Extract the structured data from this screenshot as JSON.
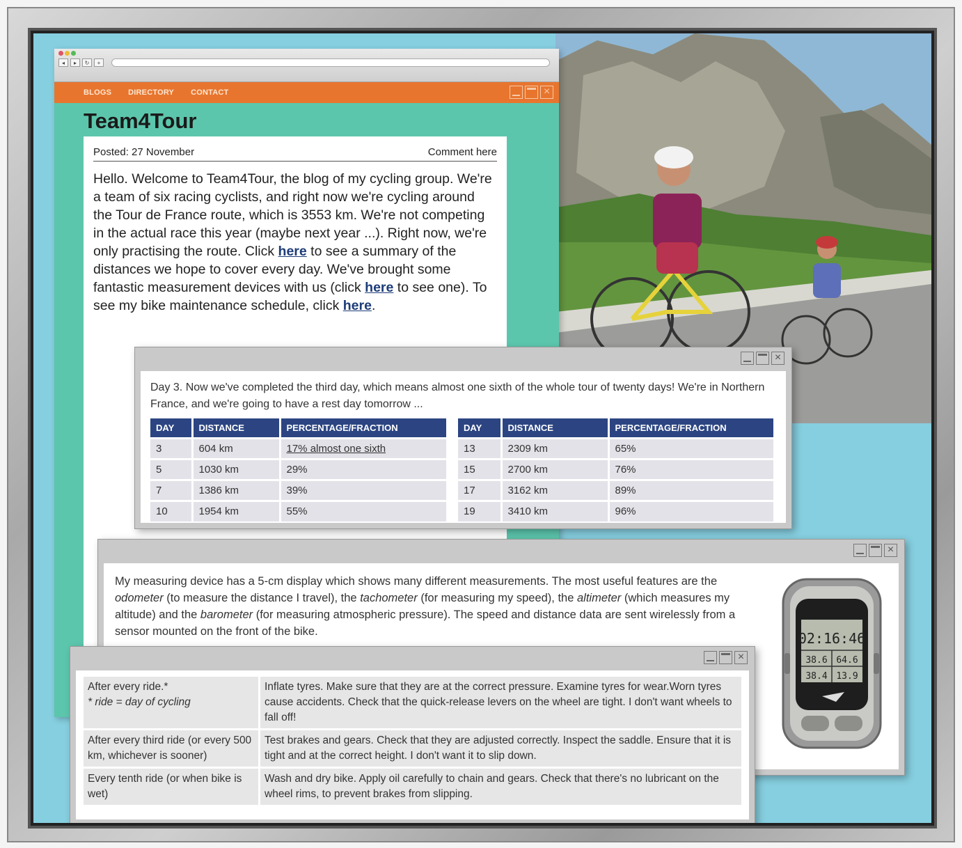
{
  "nav": {
    "links": [
      "BLOGS",
      "DIRECTORY",
      "CONTACT"
    ]
  },
  "site": {
    "title": "Team4Tour"
  },
  "post": {
    "posted": "Posted: 27 November",
    "comment": "Comment here",
    "p1": "Hello. Welcome to Team4Tour, the blog of my cycling group. We're a team of six racing cyclists, and right now we're cycling around the Tour de France route, which is 3553 km. We're not competing in the actual race this year (maybe next year ...). Right now, we're only practising the route. Click ",
    "link1": "here",
    "p2": " to see a summary of the distances we hope to cover every day. We've brought some fantastic measurement devices with us (click ",
    "link2": "here",
    "p3": " to see one). To see my bike maintenance schedule, click ",
    "link3": "here",
    "p4": "."
  },
  "distances": {
    "intro": "Day 3. Now we've completed the third day, which means almost one sixth of the whole tour of twenty days! We're in Northern France, and we're going to have a rest day tomorrow ...",
    "headers": [
      "DAY",
      "DISTANCE",
      "PERCENTAGE/FRACTION"
    ],
    "left_rows": [
      [
        "3",
        "604 km",
        "17% almost one sixth"
      ],
      [
        "5",
        "1030 km",
        "29%"
      ],
      [
        "7",
        "1386 km",
        "39%"
      ],
      [
        "10",
        "1954 km",
        "55%"
      ]
    ],
    "right_rows": [
      [
        "13",
        "2309 km",
        "65%"
      ],
      [
        "15",
        "2700 km",
        "76%"
      ],
      [
        "17",
        "3162 km",
        "89%"
      ],
      [
        "19",
        "3410 km",
        "96%"
      ]
    ]
  },
  "device": {
    "text_a": "My measuring device has a 5-cm display which shows many different measurements. The most useful features are the ",
    "odometer": "odometer",
    "text_b": " (to measure the distance I travel), the ",
    "tachometer": "tachometer",
    "text_c": " (for measuring my speed), the ",
    "altimeter": "altimeter",
    "text_d": " (which measures my altitude) and the ",
    "barometer": "barometer",
    "text_e": " (for measuring atmospheric pressure). The speed and distance data are sent wirelessly from a sensor mounted on the front of the bike.",
    "screen_time": "02:16:46",
    "screen_a": "38.6",
    "screen_b": "64.6",
    "screen_c": "38.4",
    "screen_d": "13.9"
  },
  "maintenance": [
    {
      "when": "After every ride.*",
      "note": "* ride = day of cycling",
      "task": "Inflate tyres. Make sure that they are at the correct pressure. Examine tyres for wear.Worn tyres cause accidents. Check that the quick-release levers on the wheel are tight. I don't want wheels to fall off!"
    },
    {
      "when": "After every third ride (or every 500 km, whichever is sooner)",
      "task": "Test brakes and gears. Check that they are adjusted correctly. Inspect the saddle. Ensure that it is tight and at the correct height. I don't want it to slip down."
    },
    {
      "when": "Every tenth ride (or when bike is wet)",
      "task": "Wash and dry bike. Apply oil carefully to chain and gears. Check that there's no lubricant on the wheel rims, to prevent brakes from slipping."
    }
  ]
}
